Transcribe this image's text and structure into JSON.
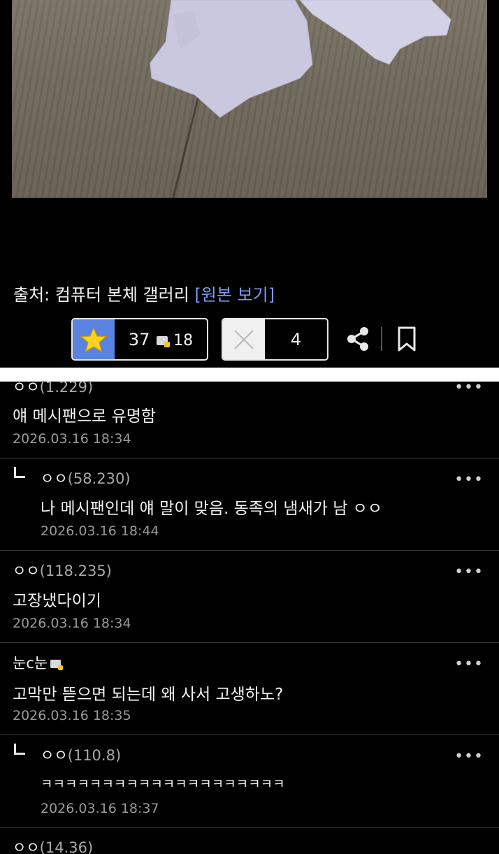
{
  "post": {
    "source_label": "출처: 컴퓨터 본체 갤러리",
    "source_link": "[원본 보기]"
  },
  "votes": {
    "recommend_count": "37",
    "fixed_recommend_count": "18",
    "nonrecommend_count": "4"
  },
  "comments": [
    {
      "author": "ㅇㅇ",
      "ip": "(1.229)",
      "text": "얘 메시팬으로 유명함",
      "date": "2026.03.16 18:34",
      "reply": false
    },
    {
      "author": "ㅇㅇ",
      "ip": "(58.230)",
      "text": "나 메시팬인데 얘 말이 맞음. 동족의 냄새가 남 ㅇㅇ",
      "date": "2026.03.16 18:44",
      "reply": true
    },
    {
      "author": "ㅇㅇ",
      "ip": "(118.235)",
      "text": "고장냈다이기",
      "date": "2026.03.16 18:34",
      "reply": false
    },
    {
      "author": "눈c눈",
      "ip": "",
      "text": "고막만 뜯으면 되는데 왜 사서 고생하노?",
      "date": "2026.03.16 18:35",
      "reply": false,
      "fixed_nick": true
    },
    {
      "author": "ㅇㅇ",
      "ip": "(110.8)",
      "text": "ㅋㅋㅋㅋㅋㅋㅋㅋㅋㅋㅋㅋㅋㅋㅋㅋㅋㅋㅋㅋ",
      "date": "2026.03.16 18:37",
      "reply": true
    },
    {
      "author": "ㅇㅇ",
      "ip": "(14.36)",
      "text": "",
      "date": "",
      "reply": false
    }
  ],
  "more_glyph": "•••",
  "colors": {
    "background": "#000000",
    "star_box": "#5a82e0",
    "source_link": "#7d9cf2",
    "date_text": "#9a9a9a"
  },
  "icons": [
    "star-icon",
    "fix-user-icon",
    "x-icon",
    "share-icon",
    "bookmark-icon",
    "more-icon",
    "reply-arrow-icon"
  ]
}
